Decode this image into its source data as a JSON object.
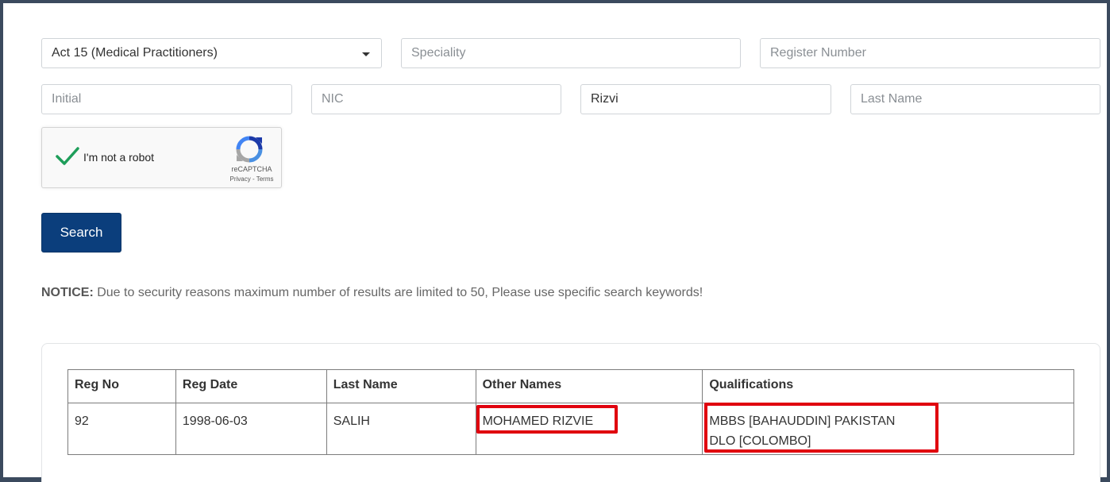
{
  "form": {
    "act_select": {
      "value": "Act 15 (Medical Practitioners)"
    },
    "speciality": {
      "placeholder": "Speciality",
      "value": ""
    },
    "register_number": {
      "placeholder": "Register Number",
      "value": ""
    },
    "initial": {
      "placeholder": "Initial",
      "value": ""
    },
    "nic": {
      "placeholder": "NIC",
      "value": ""
    },
    "other_names": {
      "value": "Rizvi"
    },
    "last_name": {
      "placeholder": "Last Name",
      "value": ""
    },
    "recaptcha": {
      "label": "I'm not a robot",
      "brand": "reCAPTCHA",
      "links": "Privacy - Terms",
      "checked": true
    },
    "search_label": "Search"
  },
  "notice": {
    "prefix": "NOTICE:",
    "text": " Due to security reasons maximum number of results are limited to 50, Please use specific search keywords!"
  },
  "results": {
    "headers": [
      "Reg No",
      "Reg Date",
      "Last Name",
      "Other Names",
      "Qualifications"
    ],
    "rows": [
      {
        "reg_no": "92",
        "reg_date": "1998-06-03",
        "last_name": "SALIH",
        "other_names": "MOHAMED RIZVIE",
        "qualifications_line1": "MBBS [BAHAUDDIN] PAKISTAN",
        "qualifications_line2": "DLO [COLOMBO]"
      }
    ]
  },
  "colors": {
    "primary_button": "#0b3e7c",
    "highlight": "#e0000e",
    "frame": "#3b4a5e"
  }
}
